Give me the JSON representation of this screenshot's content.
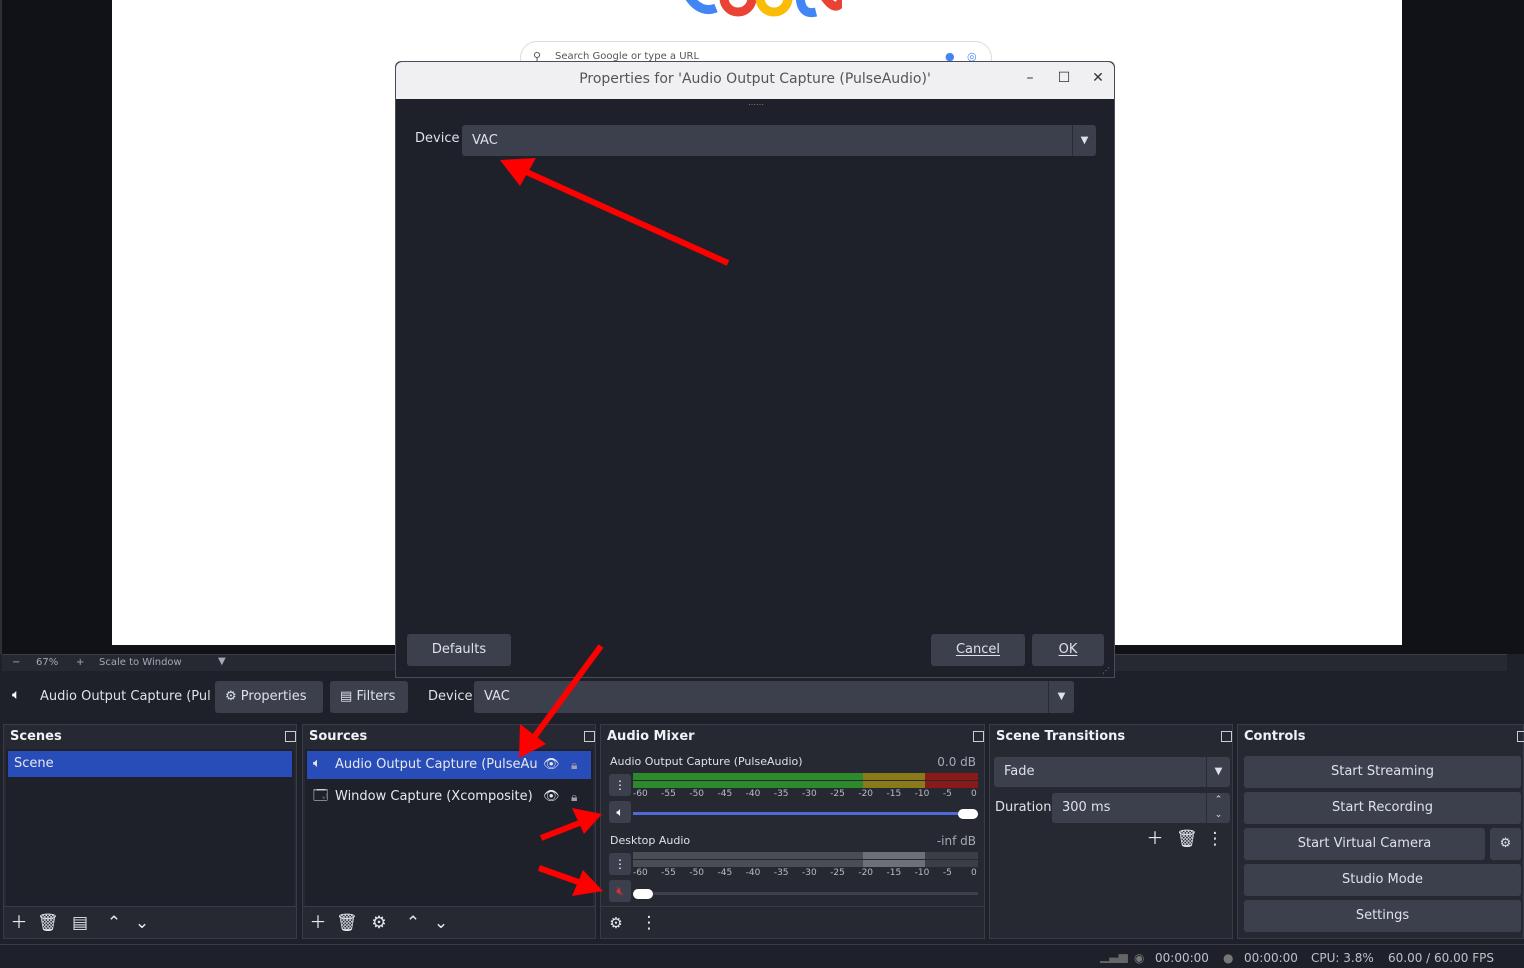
{
  "preview": {
    "search_placeholder": "Search Google or type a URL"
  },
  "zoom_bar": {
    "zoom_out": "−",
    "zoom_level": "67%",
    "zoom_in": "+",
    "scale_mode": "Scale to Window"
  },
  "context_bar": {
    "source_name": "Audio Output Capture (Pul",
    "properties_label": "Properties",
    "filters_label": "Filters",
    "device_label": "Device",
    "device_value": "VAC"
  },
  "scenes": {
    "title": "Scenes",
    "items": [
      "Scene"
    ]
  },
  "sources": {
    "title": "Sources",
    "items": [
      "Audio Output Capture (PulseAudi",
      "Window Capture (Xcomposite)"
    ]
  },
  "mixer": {
    "title": "Audio Mixer",
    "channels": [
      {
        "name": "Audio Output Capture (PulseAudio)",
        "db": "0.0 dB",
        "volume": 1.0,
        "muted": false
      },
      {
        "name": "Desktop Audio",
        "db": "-inf dB",
        "volume": 0.0,
        "muted": true
      }
    ],
    "ticks": [
      "-60",
      "-55",
      "-50",
      "-45",
      "-40",
      "-35",
      "-30",
      "-25",
      "-20",
      "-15",
      "-10",
      "-5",
      "0"
    ]
  },
  "transitions": {
    "title": "Scene Transitions",
    "type": "Fade",
    "duration_label": "Duration",
    "duration_value": "300 ms"
  },
  "controls": {
    "title": "Controls",
    "start_streaming": "Start Streaming",
    "start_recording": "Start Recording",
    "start_virtual_camera": "Start Virtual Camera",
    "studio_mode": "Studio Mode",
    "settings": "Settings"
  },
  "status_bar": {
    "stream_time": "00:00:00",
    "record_time": "00:00:00",
    "cpu": "CPU: 3.8%",
    "fps": "60.00 / 60.00 FPS"
  },
  "dialog": {
    "title": "Properties for 'Audio Output Capture (PulseAudio)'",
    "device_label": "Device",
    "device_value": "VAC",
    "defaults_label": "Defaults",
    "cancel_label": "Cancel",
    "ok_label": "OK"
  },
  "colors": {
    "accent_selected": "#284cb8",
    "annotation_arrow": "#ff0000",
    "meter_green": "#2c8a2c",
    "meter_yellow": "#8a7a1a",
    "meter_red": "#8a1a1a"
  }
}
